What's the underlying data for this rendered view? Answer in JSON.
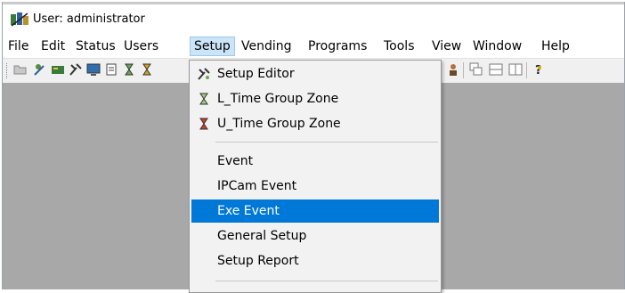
{
  "window": {
    "title": "User: administrator"
  },
  "menubar": {
    "items": [
      {
        "label": "File"
      },
      {
        "label": "Edit"
      },
      {
        "label": "Status"
      },
      {
        "label": "Users"
      },
      {
        "label": "Setup"
      },
      {
        "label": "Vending"
      },
      {
        "label": "Programs"
      },
      {
        "label": "Tools"
      },
      {
        "label": "View"
      },
      {
        "label": "Window"
      },
      {
        "label": "Help"
      }
    ],
    "active": "Setup"
  },
  "setup_menu": {
    "items": [
      {
        "label": "Setup Editor",
        "icon": "setup-editor-icon"
      },
      {
        "label": "L_Time Group Zone",
        "icon": "hourglass-green-icon"
      },
      {
        "label": "U_Time Group Zone",
        "icon": "hourglass-red-icon"
      },
      {
        "label": "Event"
      },
      {
        "label": "IPCam Event"
      },
      {
        "label": "Exe Event"
      },
      {
        "label": "General Setup"
      },
      {
        "label": "Setup Report"
      }
    ],
    "selected": "Exe Event"
  },
  "colors": {
    "highlight": "#0078d7",
    "menu_active_bg": "#cce4f7",
    "client_bg": "#a8a8a8"
  }
}
